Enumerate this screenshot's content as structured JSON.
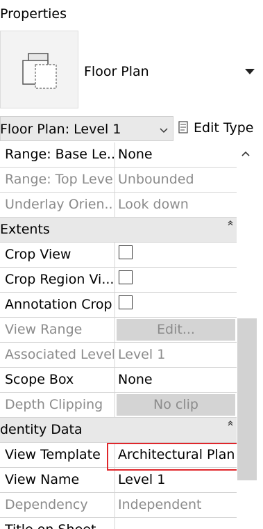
{
  "panel": {
    "title": "Properties"
  },
  "type_selector": {
    "name": "Floor Plan"
  },
  "instance": {
    "selected": "Floor Plan: Level 1",
    "edit_type_label": "Edit Type"
  },
  "rows": {
    "range_base_name": "Range: Base Le...",
    "range_base_value": "None",
    "range_top_name": "Range: Top Level",
    "range_top_value": "Unbounded",
    "underlay_name": "Underlay Orien...",
    "underlay_value": "Look down",
    "extents_group": "Extents",
    "crop_view_name": "Crop View",
    "crop_region_name": "Crop Region Vi...",
    "annotation_crop_name": "Annotation Crop",
    "view_range_name": "View Range",
    "view_range_button": "Edit...",
    "assoc_level_name": "Associated Level",
    "assoc_level_value": "Level 1",
    "scope_box_name": "Scope Box",
    "scope_box_value": "None",
    "depth_clip_name": "Depth Clipping",
    "depth_clip_button": "No clip",
    "identity_group": "dentity Data",
    "view_template_name": "View Template",
    "view_template_value": "Architectural Plan",
    "view_name_name": "View Name",
    "view_name_value": "Level 1",
    "dependency_name": "Dependency",
    "dependency_value": "Independent",
    "title_sheet_name": "Title on Sheet"
  },
  "colors": {
    "highlight": "#e0262b",
    "group_bg": "#e8e8e8",
    "disabled_text": "#8b8b8b"
  },
  "icons": [
    "floor-plan-type-icon",
    "dropdown-triangle-icon",
    "chevron-down-icon",
    "edit-type-icon",
    "collapse-icon",
    "scroll-up-icon"
  ]
}
